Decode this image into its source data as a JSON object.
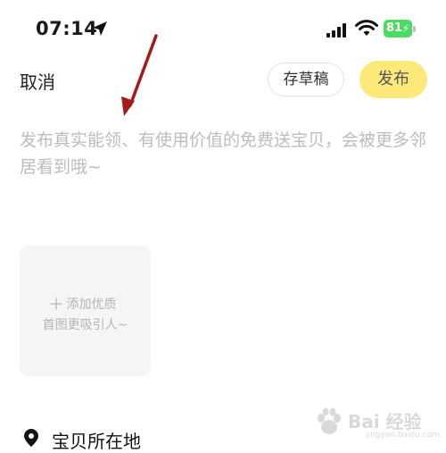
{
  "status_bar": {
    "time": "07:14",
    "battery": "81"
  },
  "header": {
    "cancel_label": "取消",
    "draft_label": "存草稿",
    "publish_label": "发布"
  },
  "description": {
    "placeholder": "发布真实能领、有使用价值的免费送宝贝，会被更多邻居看到哦~"
  },
  "photo_upload": {
    "line1": "添加优质",
    "line2": "首图更吸引人~"
  },
  "location": {
    "label": "宝贝所在地"
  },
  "watermark": {
    "text": "Bai 经验",
    "sub": "jingyan.baidu.com"
  },
  "colors": {
    "publish_bg": "#fce97a",
    "battery": "#4cd964",
    "annotation_arrow": "#a31a1a",
    "placeholder_text": "#bcbcbc"
  }
}
